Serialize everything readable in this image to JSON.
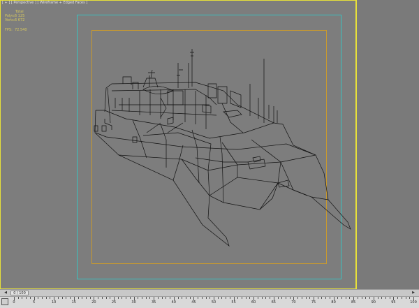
{
  "viewport": {
    "label": "[ + ] [ Perspective ] [ Wireframe + Edged Faces ]",
    "stats": {
      "total_label": "Total",
      "polys_label": "Polys:",
      "polys_value": "6 125",
      "verts_label": "Verts:",
      "verts_value": "6 672",
      "fps_label": "FPS:",
      "fps_value": "72.540"
    },
    "colors": {
      "background": "#7d7d7d",
      "active_border": "#e7e03a",
      "safe_frame_outer": "#3ac3c0",
      "safe_frame_inner": "#c99a2e",
      "wireframe": "#000000"
    },
    "nav_icon": "teapot-viewcube-icon"
  },
  "timeline": {
    "slider_label": "0 / 100",
    "prev_icon": "arrow-left-icon",
    "next_icon": "arrow-right-icon"
  },
  "ruler": {
    "icon": "key-filter-icon",
    "labels": [
      "0",
      "5",
      "10",
      "15",
      "20",
      "25",
      "30",
      "35",
      "40",
      "45",
      "50",
      "55",
      "60",
      "65",
      "70",
      "75",
      "80",
      "85",
      "90",
      "95",
      "100"
    ]
  }
}
